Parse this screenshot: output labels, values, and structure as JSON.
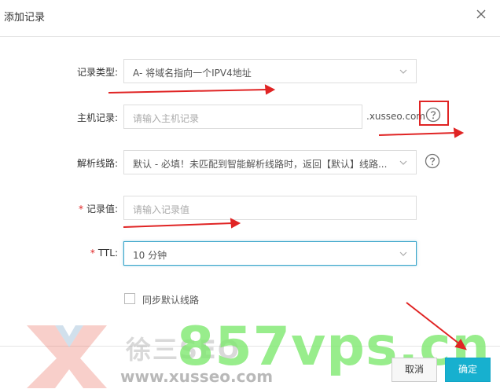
{
  "dialog": {
    "title": "添加记录"
  },
  "form": {
    "record_type": {
      "label": "记录类型:",
      "value": "A- 将域名指向一个IPV4地址"
    },
    "host": {
      "label": "主机记录:",
      "placeholder": "请输入主机记录",
      "suffix": ".xusseo.com"
    },
    "line": {
      "label": "解析线路:",
      "value": "默认 - 必填！未匹配到智能解析线路时，返回【默认】线路..."
    },
    "record_value": {
      "required_mark": "*",
      "label": "记录值:",
      "placeholder": "请输入记录值"
    },
    "ttl": {
      "required_mark": "*",
      "label": "TTL:",
      "value": "10 分钟"
    },
    "sync_default": {
      "label": "同步默认线路",
      "checked": false
    }
  },
  "footer": {
    "cancel_label": "取消",
    "ok_label": "确定"
  },
  "watermark": {
    "brand_cn": "徐三SEO",
    "domain_site": "www.xusseo.com",
    "vps_text": "857vps.cn"
  },
  "colors": {
    "accent": "#17b0cf",
    "annotation_red": "#e02424",
    "watermark_green": "#7be86b"
  }
}
